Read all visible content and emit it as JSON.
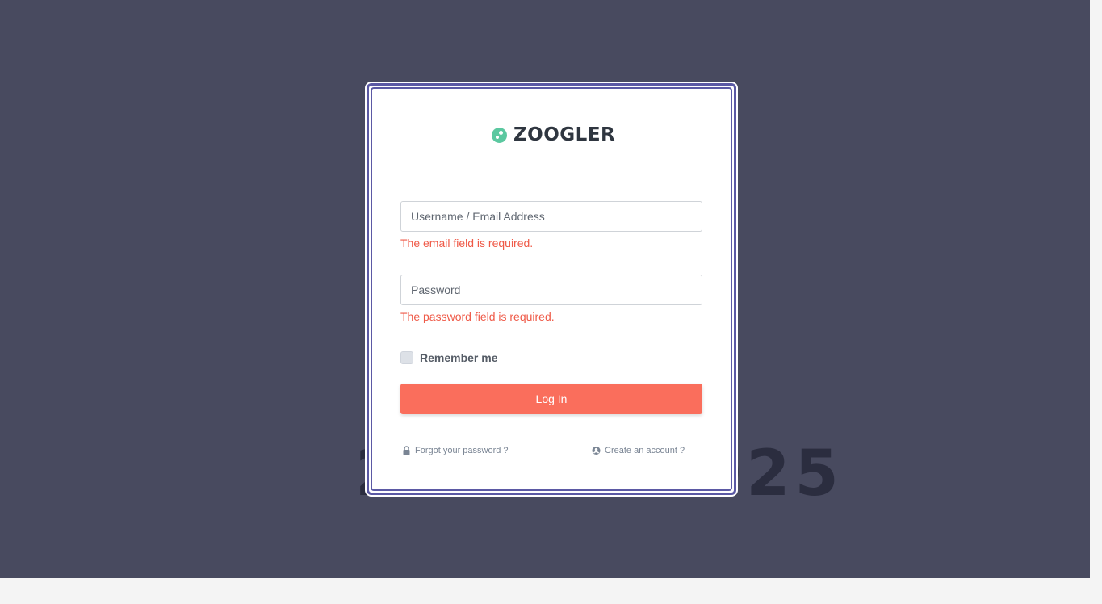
{
  "background": {
    "placeholder_text": "2000 x 1025"
  },
  "logo": {
    "brand_name": "ZOOGLER",
    "mark_color": "#5bc8a0"
  },
  "form": {
    "username_placeholder": "Username / Email Address",
    "username_value": "",
    "username_error": "The email field is required.",
    "password_placeholder": "Password",
    "password_value": "",
    "password_error": "The password field is required.",
    "remember_label": "Remember me",
    "remember_checked": false,
    "login_label": "Log In"
  },
  "links": {
    "forgot_password": "Forgot your password ?",
    "create_account": "Create an account ?"
  },
  "icons": {
    "forgot_password_icon": "lock-icon",
    "create_account_icon": "user-circle-icon"
  },
  "colors": {
    "page_bg": "#484a5f",
    "card_border": "#5b59a4",
    "button": "#fa6e5c",
    "error": "#ef5a48"
  }
}
